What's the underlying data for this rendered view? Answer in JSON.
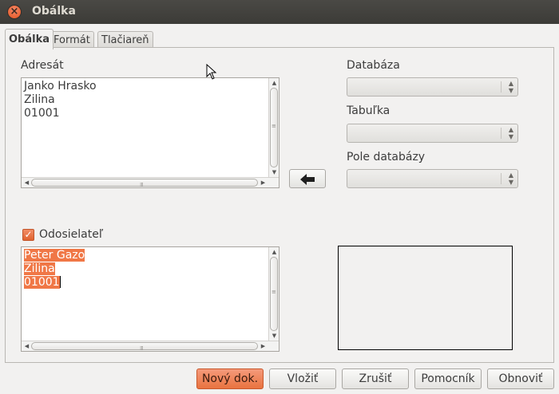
{
  "window": {
    "title": "Obálka"
  },
  "tabs": [
    {
      "label": "Obálka",
      "active": true
    },
    {
      "label": "Formát",
      "active": false
    },
    {
      "label": "Tlačiareň",
      "active": false
    }
  ],
  "addressee": {
    "label": "Adresát",
    "lines": [
      "Janko Hrasko",
      "Zilina",
      "01001"
    ]
  },
  "sender": {
    "label": "Odosielateľ",
    "checked": true,
    "lines": [
      "Peter Gazo",
      "Zilina",
      "01001"
    ]
  },
  "database": {
    "database_label": "Databáza",
    "table_label": "Tabuľka",
    "field_label": "Pole databázy",
    "database_value": "",
    "table_value": "",
    "field_value": ""
  },
  "buttons": {
    "new_doc": "Nový dok.",
    "insert": "Vložiť",
    "cancel": "Zrušiť",
    "help": "Pomocník",
    "reset": "Obnoviť"
  },
  "icons": {
    "close": "close-icon",
    "arrow_left": "arrow-left-icon",
    "checkmark": "checkmark-icon",
    "mouse_pointer": "mouse-pointer-icon"
  },
  "colors": {
    "accent": "#f07746",
    "titlebar": "#3c3b37",
    "dialog_bg": "#f2f1f0"
  }
}
